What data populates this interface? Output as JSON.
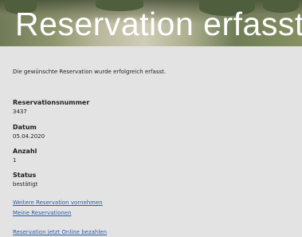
{
  "header": {
    "title": "Reservation erfasst"
  },
  "main": {
    "confirmation": "Die gewünschte Reservation wurde erfolgreich erfasst.",
    "fields": [
      {
        "label": "Reservationsnummer",
        "value": "3437"
      },
      {
        "label": "Datum",
        "value": "05.04.2020"
      },
      {
        "label": "Anzahl",
        "value": "1"
      },
      {
        "label": "Status",
        "value": "bestätigt"
      }
    ],
    "links": [
      "Weitere Reservation vornehmen",
      "Meine Reservationen",
      "Reservation jetzt Online bezahlen"
    ]
  },
  "colors": {
    "link": "#2b5da6",
    "content_background": "#e3e3e3",
    "title_text": "#ffffff"
  }
}
